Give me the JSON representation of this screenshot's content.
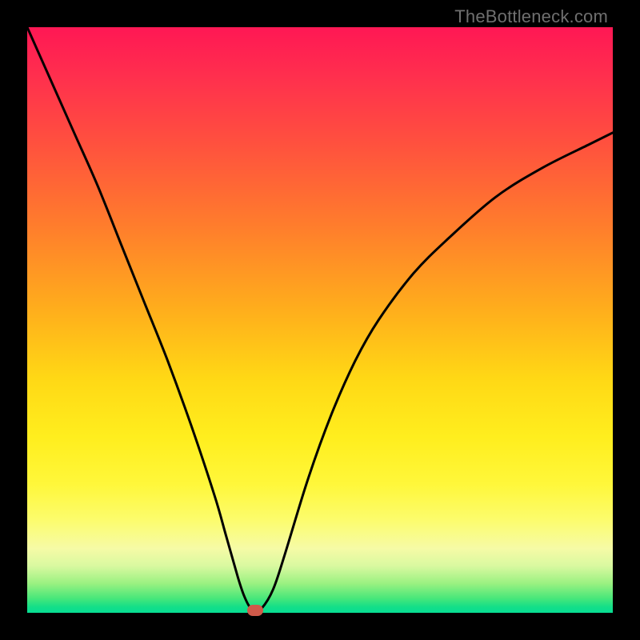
{
  "watermark": "TheBottleneck.com",
  "chart_data": {
    "type": "line",
    "title": "",
    "xlabel": "",
    "ylabel": "",
    "xlim": [
      0,
      100
    ],
    "ylim": [
      0,
      100
    ],
    "grid": false,
    "series": [
      {
        "name": "curve",
        "x": [
          0,
          4,
          8,
          12,
          16,
          20,
          24,
          28,
          32,
          34,
          36,
          37,
          38,
          39,
          40,
          42,
          44,
          48,
          52,
          56,
          60,
          66,
          72,
          80,
          88,
          96,
          100
        ],
        "y": [
          100,
          91,
          82,
          73,
          63,
          53,
          43,
          32,
          20,
          13,
          6,
          3,
          1,
          0.5,
          0.7,
          4,
          10,
          23,
          34,
          43,
          50,
          58,
          64,
          71,
          76,
          80,
          82
        ]
      }
    ],
    "marker": {
      "x": 39,
      "y": 0.35
    },
    "colors": {
      "curve": "#000000",
      "marker": "#cf5a4a",
      "gradient_top": "#ff1754",
      "gradient_bottom": "#07dd94"
    }
  }
}
